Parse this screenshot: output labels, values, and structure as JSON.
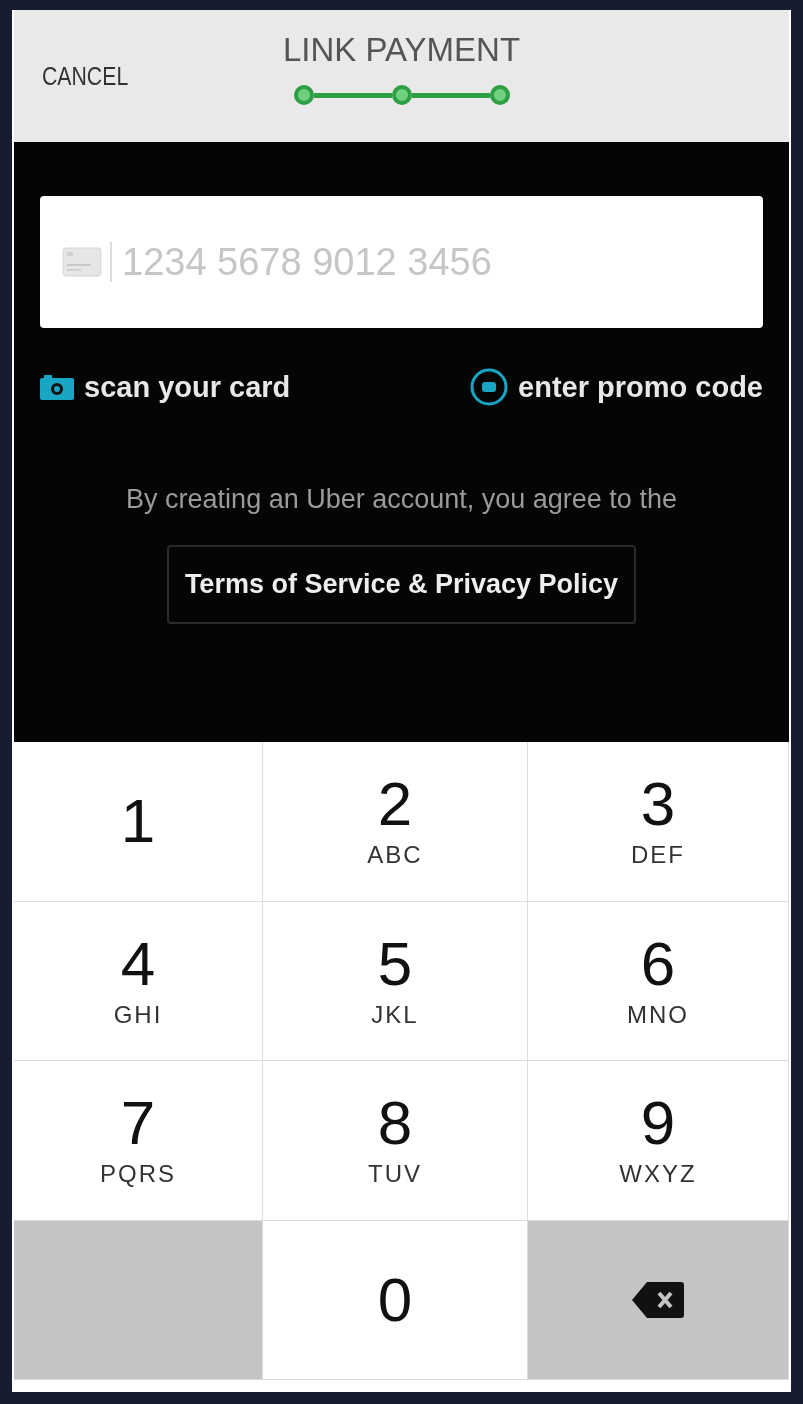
{
  "header": {
    "cancel": "CANCEL",
    "title": "LINK PAYMENT",
    "steps": [
      {
        "done": true
      },
      {
        "done": true
      },
      {
        "done": true
      }
    ]
  },
  "card_field": {
    "placeholder": "1234 5678 9012 3456"
  },
  "links": [
    {
      "kind": "camera",
      "label": "scan your card"
    },
    {
      "kind": "promo",
      "label": "enter promo code"
    }
  ],
  "agreement": "By creating an Uber account, you agree to the",
  "terms_button": "Terms of Service & Privacy Policy",
  "keypad": [
    {
      "kind": "digit",
      "digit": "1"
    },
    {
      "kind": "digit",
      "digit": "2",
      "letters": "ABC"
    },
    {
      "kind": "digit",
      "digit": "3",
      "letters": "DEF"
    },
    {
      "kind": "digit",
      "digit": "4",
      "letters": "GHI"
    },
    {
      "kind": "digit",
      "digit": "5",
      "letters": "JKL"
    },
    {
      "kind": "digit",
      "digit": "6",
      "letters": "MNO"
    },
    {
      "kind": "digit",
      "digit": "7",
      "letters": "PQRS"
    },
    {
      "kind": "digit",
      "digit": "8",
      "letters": "TUV"
    },
    {
      "kind": "digit",
      "digit": "9",
      "letters": "WXYZ"
    },
    {
      "kind": "blank"
    },
    {
      "kind": "digit",
      "digit": "0"
    },
    {
      "kind": "backspace"
    }
  ]
}
